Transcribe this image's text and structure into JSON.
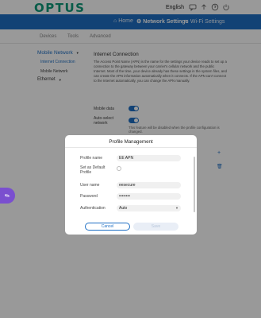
{
  "header": {
    "logo": "OPTUS",
    "language": "English",
    "icons": [
      "message-icon",
      "upload-icon",
      "help-icon",
      "logout-icon"
    ]
  },
  "nav": {
    "home": "Home",
    "network_settings": "Network Settings",
    "wifi_settings": "Wi-Fi Settings"
  },
  "subtabs": [
    "Devices",
    "Tools",
    "Advanced"
  ],
  "sidebar": {
    "heading": "Mobile Network",
    "items": [
      "Internet Connection",
      "Mobile Network"
    ],
    "ethernet": "Ethernet"
  },
  "main": {
    "title": "Internet Connection",
    "description": "The Access Point Name (APN) is the name for the settings your device reads to set up a connection to the gateway between your carrier's cellular network and the public Internet. Most of the time, your device already has these settings in the system files, and can create the APN information automatically when it connects. If the APN can't connect to the Internet automatically, you can change the APN manually.",
    "mobile_data_label": "Mobile data",
    "auto_select_label": "Auto-select network",
    "auto_select_note": "This feature will be disabled when the profile configuration is changed."
  },
  "dialog": {
    "title": "Profile Management",
    "profile_name_label": "Profile name",
    "profile_name_value": "EE APN",
    "set_default_label": "Set as Default Profile",
    "user_name_label": "User name",
    "user_name_value": "eesecure",
    "password_label": "Password",
    "password_value": "••••••••",
    "authentication_label": "Authentication",
    "authentication_value": "Auto",
    "cancel_label": "Cancel",
    "save_label": "Save"
  },
  "colors": {
    "brand": "#0f9a7a",
    "primary": "#1e6fc4",
    "fab": "#7a4fcf"
  }
}
